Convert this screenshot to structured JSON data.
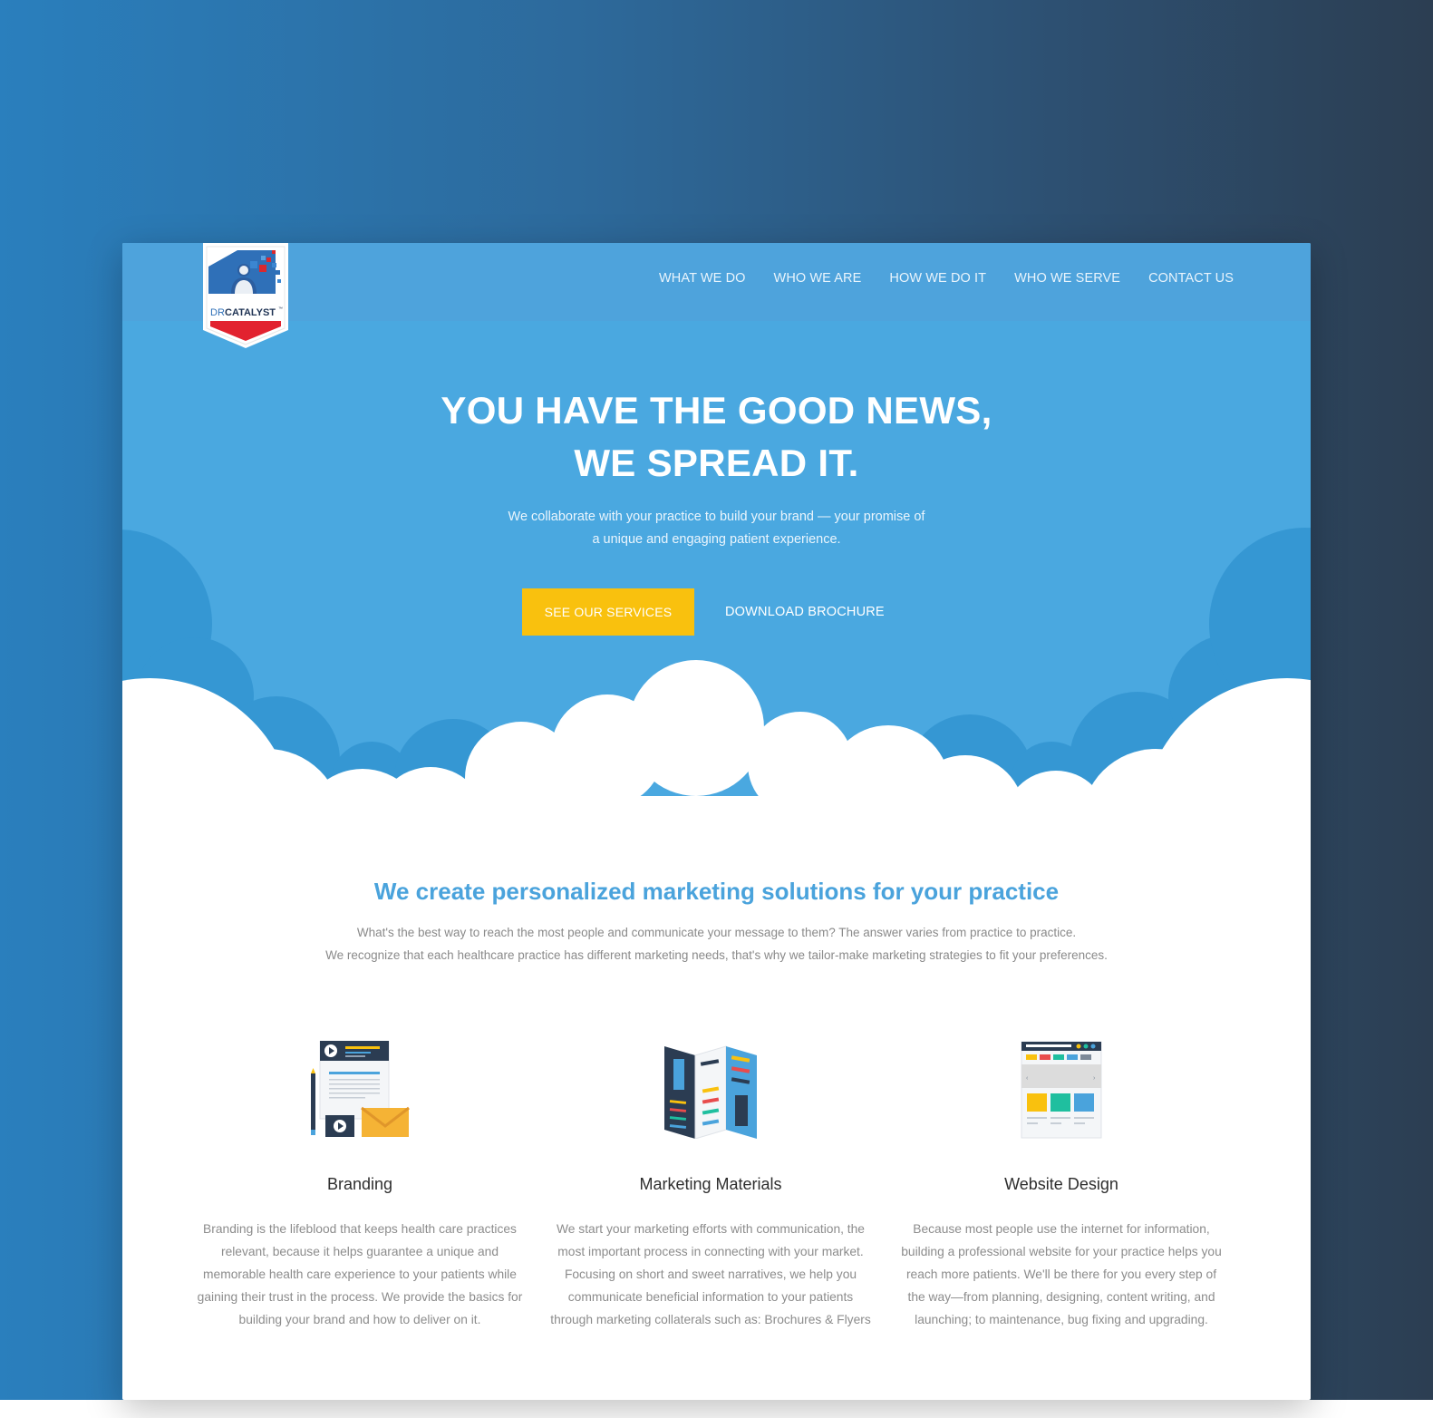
{
  "brand": {
    "logo_text_prefix": "DR",
    "logo_text_main": "CATALYST",
    "logo_tm": "™"
  },
  "nav": {
    "items": [
      {
        "label": "WHAT WE DO"
      },
      {
        "label": "WHO WE ARE"
      },
      {
        "label": "HOW WE DO IT"
      },
      {
        "label": "WHO WE SERVE"
      },
      {
        "label": "CONTACT US"
      }
    ]
  },
  "hero": {
    "headline_line1": "YOU HAVE THE GOOD NEWS,",
    "headline_line2": "WE SPREAD IT.",
    "subtitle_line1": "We collaborate with your practice to build your brand — your promise of",
    "subtitle_line2": "a unique and engaging patient experience.",
    "primary_button": "SEE OUR SERVICES",
    "secondary_button": "DOWNLOAD BROCHURE"
  },
  "intro": {
    "title": "We create personalized marketing solutions for your practice",
    "text_line1": "What's the best way to reach the most people and communicate your message to them? The answer varies from practice to practice.",
    "text_line2": "We recognize that each healthcare practice has different marketing needs, that's why we tailor-make marketing strategies to fit your preferences."
  },
  "services": [
    {
      "icon": "branding-icon",
      "title": "Branding",
      "description": "Branding is the lifeblood that keeps health care practices relevant, because it helps guarantee a unique and memorable health care experience to your patients while gaining their trust in the process. We provide the basics for building your brand and how to deliver on it."
    },
    {
      "icon": "brochure-icon",
      "title": "Marketing Materials",
      "description": "We start your marketing efforts with communication, the most important process in connecting with your market. Focusing on short and sweet narratives, we help you communicate beneficial information to your patients through marketing collaterals such as: Brochures & Flyers"
    },
    {
      "icon": "website-icon",
      "title": "Website Design",
      "description": "Because most people use the internet for information, building a professional website for your practice helps you reach more patients. We'll be there for you every step of the way—from planning, designing, content writing, and launching; to maintenance, bug fixing and upgrading."
    }
  ],
  "colors": {
    "hero_blue": "#4aa8e0",
    "cloud_dark": "#3597d3",
    "accent_yellow": "#f9c10e",
    "title_blue": "#4aa3dc"
  }
}
